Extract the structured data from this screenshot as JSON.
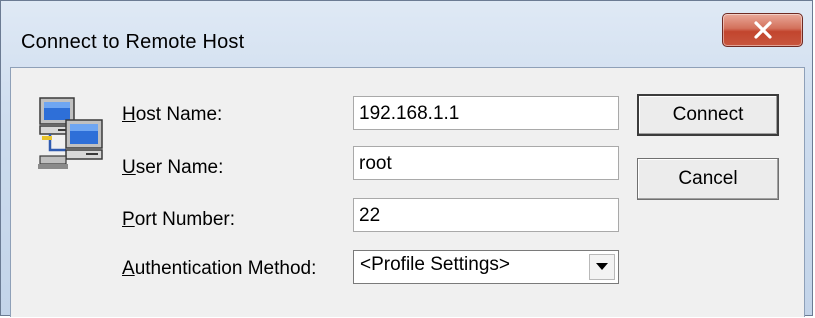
{
  "window": {
    "title": "Connect to Remote Host",
    "close_icon": "close-icon"
  },
  "app_icon": "networked-computers-icon",
  "form": {
    "host": {
      "label_key": "H",
      "label_rest": "ost Name:",
      "value": "192.168.1.1"
    },
    "user": {
      "label_key": "U",
      "label_rest": "ser Name:",
      "value": "root"
    },
    "port": {
      "label_key": "P",
      "label_rest": "ort Number:",
      "value": "22"
    },
    "auth": {
      "label_key": "A",
      "label_rest": "uthentication Method:",
      "value": "<Profile Settings>",
      "dropdown_icon": "chevron-down-icon"
    }
  },
  "buttons": {
    "connect": "Connect",
    "cancel": "Cancel"
  },
  "colors": {
    "close_button": "#c8563e",
    "title_bar": "#cddcee",
    "client_bg": "#f0f0f0"
  }
}
